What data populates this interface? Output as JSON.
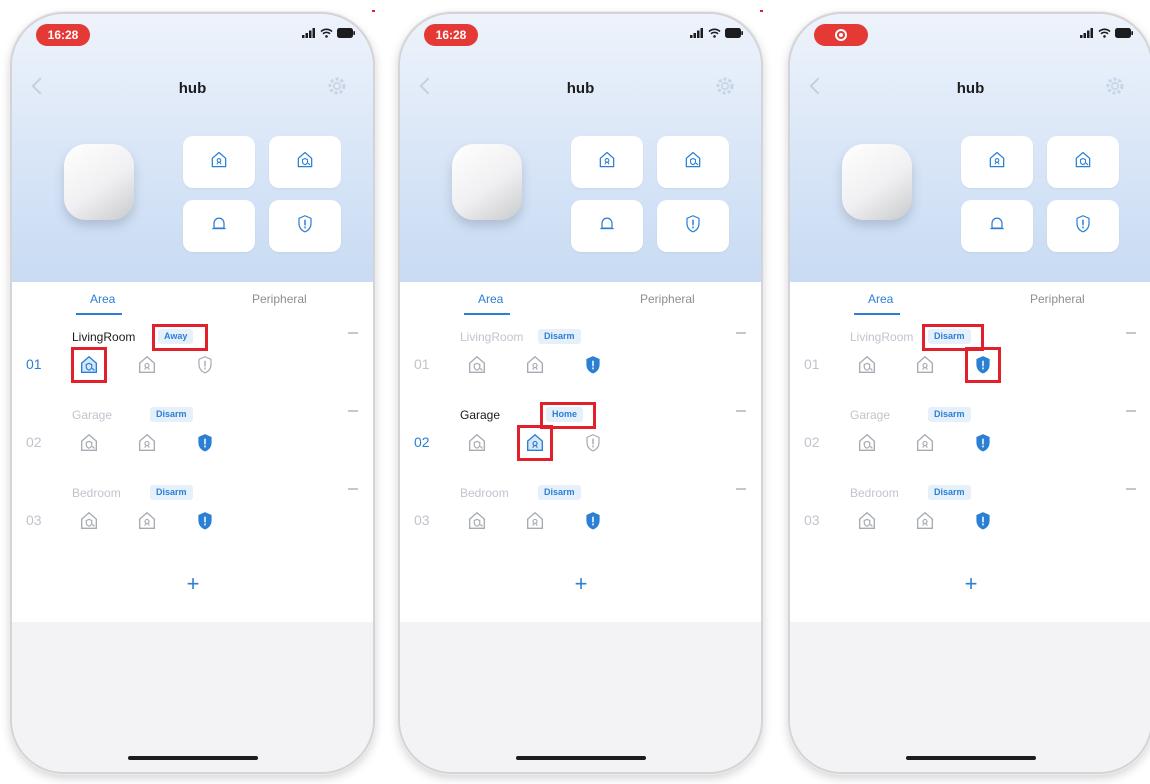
{
  "colors": {
    "accent": "#2b7fd4",
    "highlight": "#e0202a",
    "time_pill": "#e53935"
  },
  "screens": [
    {
      "status_time": "16:28",
      "title": "hub",
      "tabs": [
        "Area",
        "Peripheral"
      ],
      "areas": [
        {
          "index": "01",
          "name": "LivingRoom",
          "status": "Away",
          "active": true
        },
        {
          "index": "02",
          "name": "Garage",
          "status": "Disarm",
          "active": false
        },
        {
          "index": "03",
          "name": "Bedroom",
          "status": "Disarm",
          "active": false
        }
      ],
      "add_label": "+"
    },
    {
      "status_time": "16:28",
      "title": "hub",
      "tabs": [
        "Area",
        "Peripheral"
      ],
      "areas": [
        {
          "index": "01",
          "name": "LivingRoom",
          "status": "Disarm",
          "active": false
        },
        {
          "index": "02",
          "name": "Garage",
          "status": "Home",
          "active": true
        },
        {
          "index": "03",
          "name": "Bedroom",
          "status": "Disarm",
          "active": false
        }
      ],
      "add_label": "+"
    },
    {
      "status_time": "",
      "title": "hub",
      "tabs": [
        "Area",
        "Peripheral"
      ],
      "areas": [
        {
          "index": "01",
          "name": "LivingRoom",
          "status": "Disarm",
          "active": false
        },
        {
          "index": "02",
          "name": "Garage",
          "status": "Disarm",
          "active": false
        },
        {
          "index": "03",
          "name": "Bedroom",
          "status": "Disarm",
          "active": false
        }
      ],
      "add_label": "+"
    }
  ],
  "icons": {
    "mode_buttons": [
      "home-shield-icon",
      "away-shield-icon",
      "bell-icon",
      "shield-icon"
    ],
    "arm_row": [
      "away-arm-icon",
      "home-arm-icon",
      "disarm-shield-icon"
    ]
  }
}
